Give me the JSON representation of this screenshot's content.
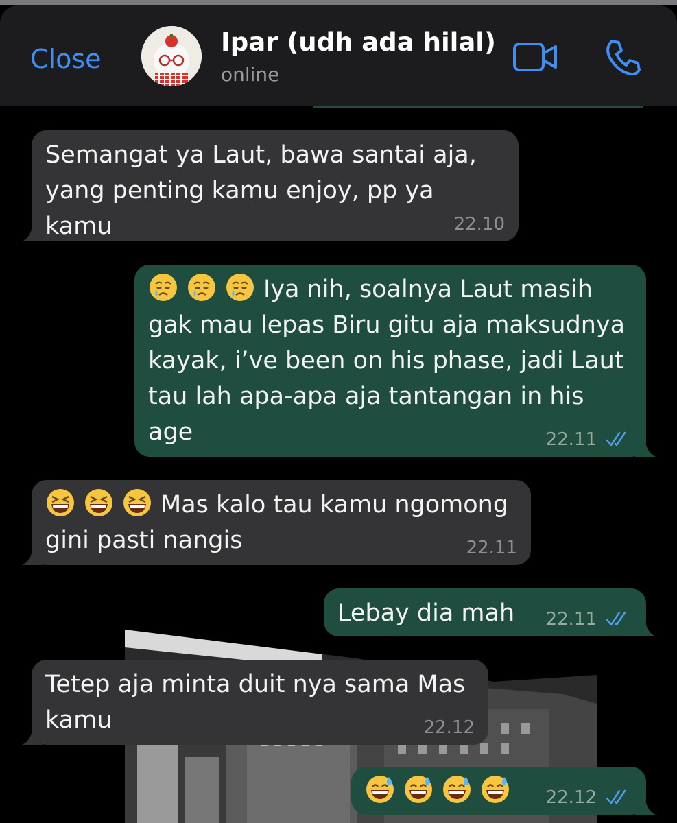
{
  "header": {
    "close_label": "Close",
    "contact_name": "Ipar (udh ada hilal)",
    "status": "online",
    "accent": "#3f8ef3"
  },
  "messages": [
    {
      "direction": "incoming",
      "text": "Semangat ya Laut, bawa santai aja, yang penting kamu enjoy, pp ya kamu",
      "time": "22.10"
    },
    {
      "direction": "outgoing",
      "emoji": [
        "crying-face",
        "crying-face",
        "crying-face"
      ],
      "text": "Iya nih, soalnya Laut masih gak mau lepas Biru gitu aja maksudnya kayak, i’ve been on his phase, jadi Laut tau lah apa-apa aja tantangan in his age",
      "time": "22.11",
      "read": true
    },
    {
      "direction": "incoming",
      "emoji": [
        "grinning-squinting-face",
        "grinning-squinting-face",
        "grinning-squinting-face"
      ],
      "text": "Mas kalo tau kamu ngomong gini pasti nangis",
      "time": "22.11"
    },
    {
      "direction": "outgoing",
      "text": "Lebay dia mah",
      "time": "22.11",
      "read": true
    },
    {
      "direction": "incoming",
      "text": "Tetep aja minta duit nya sama Mas kamu",
      "time": "22.12"
    },
    {
      "direction": "outgoing",
      "emoji": [
        "sweat-smile-face",
        "sweat-smile-face",
        "sweat-smile-face",
        "sweat-smile-face"
      ],
      "text": "",
      "time": "22.12",
      "read": true
    }
  ],
  "colors": {
    "incoming_bubble": "#343436",
    "outgoing_bubble": "#1f4e40",
    "read_tick": "#53a3f5"
  }
}
